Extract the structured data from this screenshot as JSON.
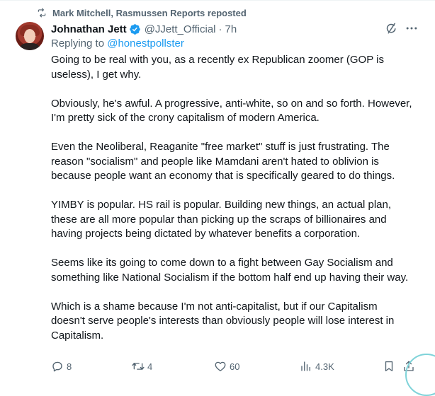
{
  "repost": {
    "icon": "repost-icon",
    "text": "Mark Mitchell, Rasmussen Reports reposted"
  },
  "author": {
    "name": "Johnathan Jett",
    "verified": true,
    "verified_color": "#1d9bf0",
    "handle": "@JJett_Official",
    "separator": "·",
    "time": "7h"
  },
  "reply": {
    "prefix": "Replying to",
    "to": "@honestpollster"
  },
  "body": {
    "paragraphs": [
      "Going to be real with you, as a recently ex Republican zoomer (GOP is useless), I get why.",
      "Obviously, he's awful. A progressive, anti-white, so on and so forth. However, I'm pretty sick of the crony capitalism of modern America.",
      "Even the Neoliberal, Reaganite \"free market\" stuff is just frustrating. The reason \"socialism\" and people like Mamdani aren't hated to oblivion is because people want an economy that is specifically geared to do things.",
      "YIMBY is popular. HS rail is popular. Building new things, an actual plan, these are all more popular than picking up the scraps of billionaires and having projects being dictated by whatever benefits a corporation.",
      "Seems like its going to come down to a fight between Gay Socialism and something like National Socialism if the bottom half end up having their way.",
      "Which is a shame because I'm not anti-capitalist, but if our Capitalism doesn't serve people's interests than obviously people will lose interest in Capitalism."
    ]
  },
  "actions": {
    "reply_count": "8",
    "repost_count": "4",
    "like_count": "60",
    "views_count": "4.3K"
  },
  "colors": {
    "text": "#0f1419",
    "muted": "#536471",
    "link": "#1d9bf0"
  }
}
